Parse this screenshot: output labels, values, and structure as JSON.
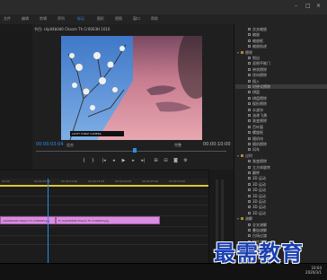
{
  "menu": {
    "items": [
      "文件",
      "编辑",
      "剪辑",
      "序列",
      "标记",
      "图形",
      "视图",
      "窗口",
      "帮助"
    ],
    "active_index": 4
  },
  "monitor": {
    "title": "节目: clip04b0d0 Chasm Th Cr0003H 1010",
    "timecode_current": "00:00:03:04",
    "fit": "适合",
    "resolution": "完整",
    "timecode_total": "00:00:10:00",
    "preview_caption": "LIGHT TABLE CAMERA"
  },
  "timeline": {
    "ticks": [
      "00:00",
      "00:00:05:00",
      "00:00:10:00",
      "00:00:15:00",
      "00:00:20:00",
      "00:00:25:00",
      "00:00:30:00"
    ],
    "clipA_label": "clip04b0d0 Chasm Th Cr0003H.jpg",
    "clipB_label": "fx clip04b0d0 Chasm Th Cr0003H.jpg"
  },
  "effects": {
    "rows": [
      {
        "label": "交叉缩放",
        "level": 1,
        "folder": false,
        "selected": false
      },
      {
        "label": "缩放",
        "level": 1,
        "folder": false,
        "selected": false
      },
      {
        "label": "缩放框",
        "level": 1,
        "folder": false,
        "selected": false
      },
      {
        "label": "缩放轨迹",
        "level": 1,
        "folder": false,
        "selected": false
      },
      {
        "label": "擦除",
        "level": 0,
        "folder": true,
        "selected": false
      },
      {
        "label": "划出",
        "level": 1,
        "folder": false,
        "selected": false
      },
      {
        "label": "双侧平推门",
        "level": 1,
        "folder": false,
        "selected": false
      },
      {
        "label": "带状擦除",
        "level": 1,
        "folder": false,
        "selected": false
      },
      {
        "label": "径向擦除",
        "level": 1,
        "folder": false,
        "selected": false
      },
      {
        "label": "插入",
        "level": 1,
        "folder": false,
        "selected": false
      },
      {
        "label": "时钟式擦除",
        "level": 1,
        "folder": false,
        "selected": true
      },
      {
        "label": "棋盘",
        "level": 1,
        "folder": false,
        "selected": false
      },
      {
        "label": "棋盘擦除",
        "level": 1,
        "folder": false,
        "selected": false
      },
      {
        "label": "楔形擦除",
        "level": 1,
        "folder": false,
        "selected": false
      },
      {
        "label": "水波块",
        "level": 1,
        "folder": false,
        "selected": false
      },
      {
        "label": "油漆飞溅",
        "level": 1,
        "folder": false,
        "selected": false
      },
      {
        "label": "渐变擦除",
        "level": 1,
        "folder": false,
        "selected": false
      },
      {
        "label": "百叶窗",
        "level": 1,
        "folder": false,
        "selected": false
      },
      {
        "label": "螺旋框",
        "level": 1,
        "folder": false,
        "selected": false
      },
      {
        "label": "随机块",
        "level": 1,
        "folder": false,
        "selected": false
      },
      {
        "label": "随机擦除",
        "level": 1,
        "folder": false,
        "selected": false
      },
      {
        "label": "风车",
        "level": 1,
        "folder": false,
        "selected": false
      },
      {
        "label": "过时",
        "level": 0,
        "folder": true,
        "selected": false
      },
      {
        "label": "渐变擦除",
        "level": 1,
        "folder": false,
        "selected": false
      },
      {
        "label": "立方体旋转",
        "level": 1,
        "folder": false,
        "selected": false
      },
      {
        "label": "翻转",
        "level": 1,
        "folder": false,
        "selected": false
      },
      {
        "label": "3D 运动",
        "level": 1,
        "folder": false,
        "selected": false
      },
      {
        "label": "3D 运动",
        "level": 1,
        "folder": false,
        "selected": false
      },
      {
        "label": "3D 运动",
        "level": 1,
        "folder": false,
        "selected": false
      },
      {
        "label": "3D 运动",
        "level": 1,
        "folder": false,
        "selected": false
      },
      {
        "label": "3D 运动",
        "level": 1,
        "folder": false,
        "selected": false
      },
      {
        "label": "3D 运动",
        "level": 1,
        "folder": false,
        "selected": false
      },
      {
        "label": "3D 运动",
        "level": 1,
        "folder": false,
        "selected": false
      },
      {
        "label": "溶解",
        "level": 0,
        "folder": true,
        "selected": false
      },
      {
        "label": "交叉溶解",
        "level": 1,
        "folder": false,
        "selected": false
      },
      {
        "label": "叠加溶解",
        "level": 1,
        "folder": false,
        "selected": false
      },
      {
        "label": "白场过渡",
        "level": 1,
        "folder": false,
        "selected": false
      },
      {
        "label": "胶片溶解",
        "level": 1,
        "folder": false,
        "selected": false
      },
      {
        "label": "非叠加溶解",
        "level": 1,
        "folder": false,
        "selected": false
      },
      {
        "label": "黑场过渡",
        "level": 1,
        "folder": false,
        "selected": false
      }
    ]
  },
  "taskbar": {
    "clock_time": "10:04",
    "clock_date": "2020/3/1"
  },
  "watermark": "最需教育",
  "colors": {
    "accent": "#2d8ceb",
    "clip": "#d98ee0",
    "workarea": "#e2c531"
  }
}
